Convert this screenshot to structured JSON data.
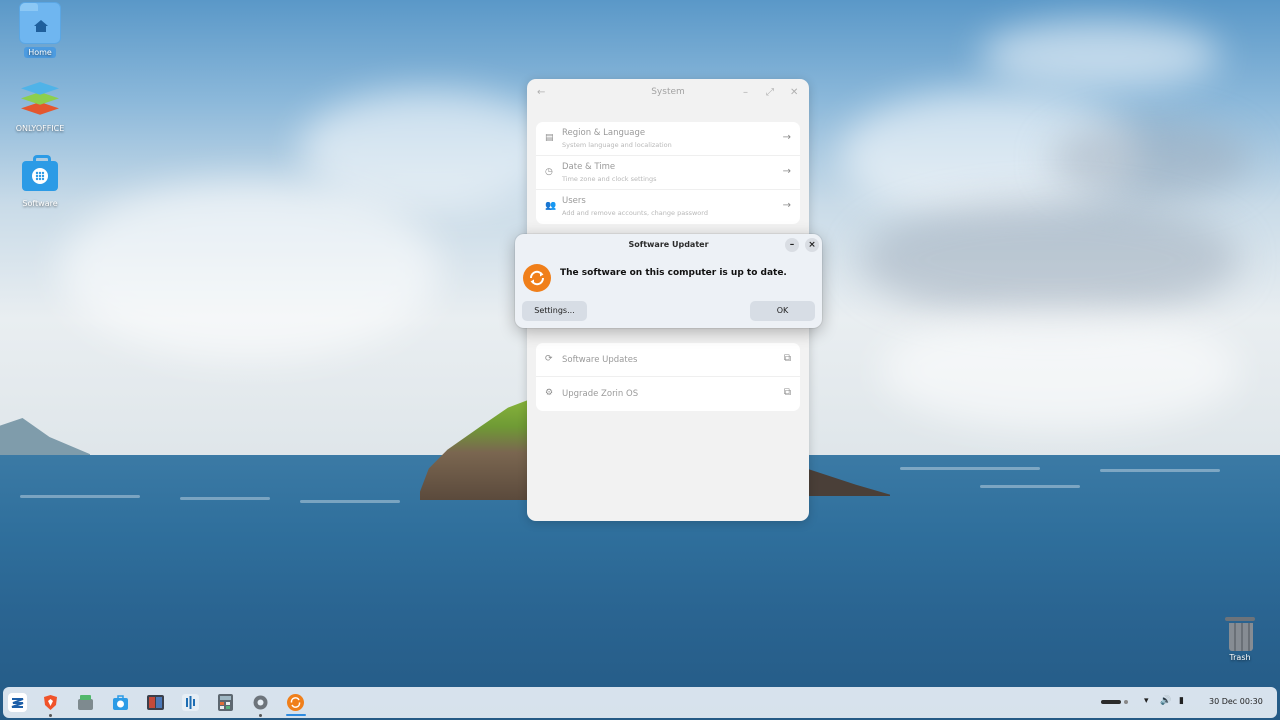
{
  "desktop": {
    "icons": [
      {
        "label": "Home"
      },
      {
        "label": "ONLYOFFICE"
      },
      {
        "label": "Software"
      }
    ],
    "trash_label": "Trash"
  },
  "system_window": {
    "title": "System",
    "top_items": [
      {
        "title": "Region & Language",
        "subtitle": "System language and localization",
        "icon": "region-icon"
      },
      {
        "title": "Date & Time",
        "subtitle": "Time zone and clock settings",
        "icon": "clock-icon"
      },
      {
        "title": "Users",
        "subtitle": "Add and remove accounts, change password",
        "icon": "users-icon"
      }
    ],
    "bottom_items": [
      {
        "title": "Software Updates",
        "icon": "refresh-icon"
      },
      {
        "title": "Upgrade Zorin OS",
        "icon": "gear-icon"
      }
    ]
  },
  "dialog": {
    "title": "Software Updater",
    "message": "The software on this computer is up to date.",
    "settings_label": "Settings...",
    "ok_label": "OK"
  },
  "taskbar": {
    "apps": [
      "zorin-menu",
      "brave-browser",
      "files",
      "software-store",
      "terminal-app",
      "audio-app",
      "calculator",
      "settings",
      "software-updater"
    ],
    "clock": "30 Dec  00:30"
  },
  "colors": {
    "accent": "#2d8be0",
    "updater_orange": "#f07f1a"
  }
}
